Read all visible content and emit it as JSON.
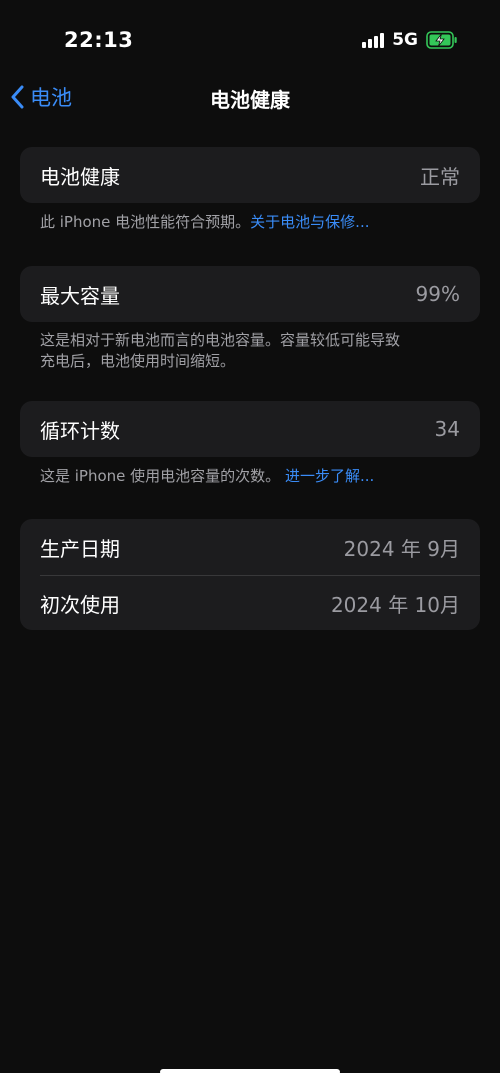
{
  "status_bar": {
    "time": "22:13",
    "network": "5G",
    "signal_bars": 4,
    "battery_charging": true,
    "battery_color": "#34c759"
  },
  "nav": {
    "back_label": "电池",
    "title": "电池健康"
  },
  "battery_health": {
    "label": "电池健康",
    "value": "正常",
    "footnote": "此 iPhone 电池性能符合预期。",
    "footnote_link": "关于电池与保修..."
  },
  "max_capacity": {
    "label": "最大容量",
    "value": "99%",
    "footnote_line1": "这是相对于新电池而言的电池容量。容量较低可能导致",
    "footnote_line2": "充电后，电池使用时间缩短。"
  },
  "cycle_count": {
    "label": "循环计数",
    "value": "34",
    "footnote": "这是 iPhone 使用电池容量的次数。",
    "footnote_link": "进一步了解..."
  },
  "dates": {
    "manufacture_label": "生产日期",
    "manufacture_value": "2024 年 9月",
    "first_use_label": "初次使用",
    "first_use_value": "2024 年 10月"
  },
  "colors": {
    "accent": "#3a8cf7",
    "background": "#0d0d0d",
    "card": "#1c1c1e"
  }
}
